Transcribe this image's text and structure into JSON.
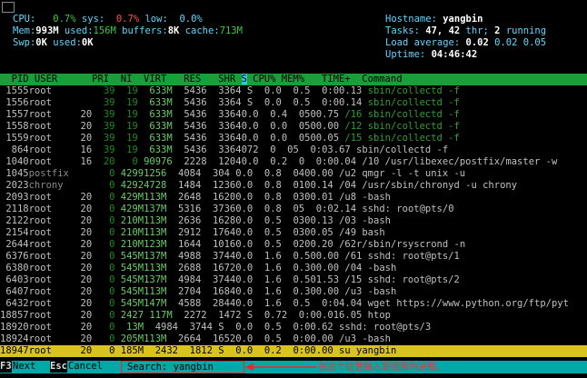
{
  "meters": {
    "cpu_label": "CPU:",
    "cpu_usr": "0.7%",
    "sys_label": "sys:",
    "sys_val": "0.7%",
    "low_label": "low:",
    "low_val": "0.0%",
    "mem_label": "Mem:",
    "mem_total": "993M",
    "used_label": "used:",
    "mem_used": "156M",
    "buffers_label": "buffers:",
    "buffers_val": "8K",
    "cache_label": "cache:",
    "cache_val": "713M",
    "swp_label": "Swp:",
    "swp_total": "0K",
    "swp_used_label": "used:",
    "swp_used": "0K"
  },
  "sysinfo": {
    "hostname_label": "Hostname:",
    "hostname": "yangbin",
    "tasks_label": "Tasks:",
    "tasks": "47,",
    "thr": "42",
    "thr_label": "thr;",
    "running": "2",
    "running_label": "running",
    "load_label": "Load average:",
    "load1": "0.02",
    "load5": "0.02",
    "load15": "0.05",
    "uptime_label": "Uptime:",
    "uptime": "04:46:42"
  },
  "header": {
    "pre": "  PID USER      PRI  NI  VIRT   RES   SHR ",
    "sort": "S",
    "post": " CPU% MEM%   TIME+  Command"
  },
  "rows": [
    {
      "pid": " 1555",
      "user": "root     ",
      "pri": "  ",
      "ni": "  39",
      "virt": "  19",
      "res": "  633M",
      "shr": "  5436",
      "s": "  3364",
      "cpu": " S",
      "mem": "  0.0",
      "time": "  0.5",
      "cmd": "  0:00.13",
      "tail": " sbin/collectd -f",
      "dim": true
    },
    {
      "pid": " 1556",
      "user": "root     ",
      "pri": "  ",
      "ni": "  39",
      "virt": "  19",
      "res": "  633M",
      "shr": "  5436",
      "s": "  3364",
      "cpu": " S",
      "mem": "  0.0",
      "time": "  0.5",
      "cmd": "  0:00.14",
      "tail": " sbin/collectd -f",
      "dim": true
    },
    {
      "pid": " 1557",
      "user": "root     ",
      "pri": "20",
      "ni": "  39",
      "virt": "  19",
      "res": "  633M",
      "shr": "  5436",
      "s": "  33640",
      "cpu": ".0",
      "mem": "  0.4",
      "time": "  0500",
      "cmd": ".75",
      "tail": " /16 sbin/collectd -f",
      "dim": true
    },
    {
      "pid": " 1558",
      "user": "root     ",
      "pri": "20",
      "ni": "  39",
      "virt": "  19",
      "res": "  633M",
      "shr": "  5436",
      "s": "  33640",
      "cpu": ".0",
      "mem": "  0.0",
      "time": "  0500",
      "cmd": ".00",
      "tail": " /12 sbin/collectd -f",
      "dim": true
    },
    {
      "pid": " 1559",
      "user": "root     ",
      "pri": "20",
      "ni": "  39",
      "virt": "  19",
      "res": "  633M",
      "shr": "  5436",
      "s": "  33640",
      "cpu": ".0",
      "mem": "  0.0",
      "time": "  0500",
      "cmd": ".05",
      "tail": " /15 sbin/collectd -f",
      "dim": true
    },
    {
      "pid": "  864",
      "user": "root     ",
      "pri": "16",
      "ni": "  39",
      "virt": "  19",
      "res": "  633M",
      "shr": "  5436",
      "s": "  33640",
      "cpu": "72",
      "mem": "  0",
      "time": "  05",
      "cmd": "  0:03.67",
      "tail": " sbin/collectd -f",
      "dim": false
    },
    {
      "pid": " 1040",
      "user": "root     ",
      "pri": "16",
      "ni": "  20",
      "virt": "   0",
      "res": " 90976",
      "shr": "  2228",
      "s": "  12040",
      "cpu": ".0",
      "mem": "  0.2",
      "time": "  0",
      "cmd": "  0:00.04",
      "tail": " /10 /usr/libexec/postfix/master -w",
      "dim": false
    },
    {
      "pid": " 1045",
      "user": "postfix  ",
      "pri": "  ",
      "ni": "   0",
      "virt": "",
      "res": " 42991256",
      "shr": "  4084",
      "s": "  304",
      "cpu": " 0.0",
      "mem": "  0.8",
      "time": "  0400",
      "cmd": ".00",
      "tail": " /u2 qmgr -l -t unix -u",
      "dim": false,
      "gray": true
    },
    {
      "pid": " 2023",
      "user": "chrony   ",
      "pri": "  ",
      "ni": "   0",
      "virt": "",
      "res": " 42924728",
      "shr": "  1484",
      "s": "  12360",
      "cpu": ".0",
      "mem": "  0.8",
      "time": "  0100",
      "cmd": ".14",
      "tail": " /04 /usr/sbin/chronyd -u chrony",
      "dim": false,
      "gray": true
    },
    {
      "pid": " 2093",
      "user": "root     ",
      "pri": "20",
      "ni": "   0",
      "virt": "",
      "res": " 429M113M",
      "shr": "  2648",
      "s": "  16200",
      "cpu": ".0",
      "mem": "  0.8",
      "time": "  0300",
      "cmd": ".01",
      "tail": " /u8 -bash",
      "dim": false
    },
    {
      "pid": " 2118",
      "user": "root     ",
      "pri": "20",
      "ni": "   0",
      "virt": "",
      "res": " 429M137M",
      "shr": "  5316",
      "s": "  37360",
      "cpu": ".0",
      "mem": "  0.8",
      "time": "  05",
      "cmd": "  0:02.14",
      "tail": " sshd: root@pts/0",
      "dim": false
    },
    {
      "pid": " 2122",
      "user": "root     ",
      "pri": "20",
      "ni": "   0",
      "virt": "",
      "res": " 210M113M",
      "shr": "  2636",
      "s": "  16280",
      "cpu": ".0",
      "mem": "  0.5",
      "time": "  0300",
      "cmd": ".13",
      "tail": " /03 -bash",
      "dim": false
    },
    {
      "pid": " 2154",
      "user": "root     ",
      "pri": "20",
      "ni": "   0",
      "virt": "",
      "res": " 210M113M",
      "shr": "  2912",
      "s": "  17640",
      "cpu": ".0",
      "mem": "  0.5",
      "time": "  0300",
      "cmd": ".05",
      "tail": " /49 bash",
      "dim": false
    },
    {
      "pid": " 2644",
      "user": "root     ",
      "pri": "20",
      "ni": "   0",
      "virt": "",
      "res": " 210M123M",
      "shr": "  1644",
      "s": "  10160",
      "cpu": ".0",
      "mem": "  0.5",
      "time": "  0200",
      "cmd": ".20",
      "tail": " /62r/sbin/rsyscrond -n",
      "dim": false
    },
    {
      "pid": " 6376",
      "user": "root     ",
      "pri": "20",
      "ni": "   0",
      "virt": "",
      "res": " 545M137M",
      "shr": "  4988",
      "s": "  37440",
      "cpu": ".0",
      "mem": "  1.6",
      "time": "  0.500",
      "cmd": ".00",
      "tail": " /61 sshd: root@pts/1",
      "dim": false
    },
    {
      "pid": " 6380",
      "user": "root     ",
      "pri": "20",
      "ni": "   0",
      "virt": "",
      "res": " 545M113M",
      "shr": "  2688",
      "s": "  16720",
      "cpu": ".0",
      "mem": "  1.6",
      "time": "  0.300",
      "cmd": ".00",
      "tail": " /04 -bash",
      "dim": false
    },
    {
      "pid": " 6403",
      "user": "root     ",
      "pri": "20",
      "ni": "   0",
      "virt": "",
      "res": " 545M137M",
      "shr": "  4984",
      "s": "  37440",
      "cpu": ".0",
      "mem": "  1.6",
      "time": "  0.501",
      "cmd": ".53",
      "tail": " /15 sshd: root@pts/2",
      "dim": false
    },
    {
      "pid": " 6407",
      "user": "root     ",
      "pri": "20",
      "ni": "   0",
      "virt": "",
      "res": " 545M113M",
      "shr": "  2704",
      "s": "  16840",
      "cpu": ".0",
      "mem": "  1.6",
      "time": "  0.300",
      "cmd": ".00",
      "tail": " /u3 -bash",
      "dim": false
    },
    {
      "pid": " 6432",
      "user": "root     ",
      "pri": "20",
      "ni": "   0",
      "virt": "",
      "res": " 545M147M",
      "shr": "  4588",
      "s": "  28440",
      "cpu": ".0",
      "mem": "  1.6",
      "time": "  0.5",
      "cmd": "  0:04.04",
      "tail": " wget https://www.python.org/ftp/pyt",
      "dim": false
    },
    {
      "pid": "18857",
      "user": "root     ",
      "pri": "20",
      "ni": "   0",
      "virt": "",
      "res": " 2427 117M",
      "shr": "  2272",
      "s": "  1472",
      "cpu": " S",
      "mem": "  0.72",
      "time": "  0:00",
      "cmd": ".016.05",
      "tail": " htop",
      "dim": false
    },
    {
      "pid": "18920",
      "user": "root     ",
      "pri": "20",
      "ni": "   0",
      "virt": "",
      "res": "  13M",
      "shr": "  4984",
      "s": "  3744",
      "cpu": " S",
      "mem": "  0.0",
      "time": "  0.5",
      "cmd": "  0:00.62",
      "tail": " sshd: root@pts/3",
      "dim": false
    },
    {
      "pid": "18924",
      "user": "root     ",
      "pri": "20",
      "ni": "   0",
      "virt": "",
      "res": " 205M113M",
      "shr": "  2664",
      "s": "  16520",
      "cpu": ".0",
      "mem": "  0.5",
      "time": "  0:00",
      "cmd": ".00",
      "tail": " /u3 -bash",
      "dim": false
    },
    {
      "pid": "18947",
      "user": "root     ",
      "pri": "20",
      "ni": "   0",
      "virt": "",
      "res": " 185M",
      "shr": "  2432",
      "s": "  1812",
      "cpu": " S",
      "mem": "  0.0",
      "time": "  0.2",
      "cmd": "  0:00.00",
      "tail": " su yangbin",
      "dim": false,
      "selected": true
    }
  ],
  "footer": {
    "f3": "F3",
    "next": "Next",
    "esc": "Esc",
    "cancel": "Cancel",
    "search_label": "Search:",
    "search_value": "yangbin"
  },
  "annotation": "在这个位置输入要搜索的进程。"
}
